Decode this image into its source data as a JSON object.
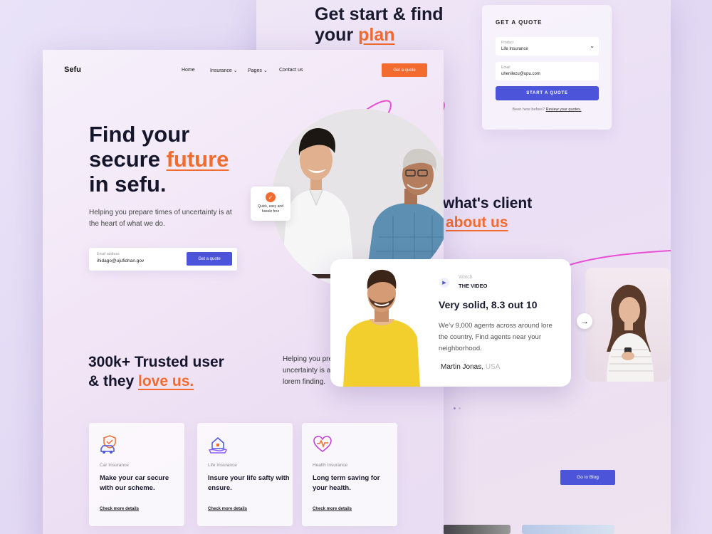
{
  "back": {
    "heading_l1": "Get start & find",
    "heading_l2a": "your ",
    "heading_l2b": "plan",
    "quote": {
      "title": "GET A QUOTE",
      "product_label": "Product",
      "product_value": "Life Insurance",
      "email_label": "Email",
      "email_value": "uhenilezu@upu.com",
      "button": "START A QUOTE",
      "note": "Been here before?",
      "note_link": "Review your quotes."
    },
    "client_l1": "what's client",
    "client_l2": "about us",
    "blog_button": "Go to Blog"
  },
  "front": {
    "logo": "Sefu",
    "nav": [
      "Home",
      "Insurance",
      "Pages",
      "Contact us"
    ],
    "header_button": "Get a quote",
    "hero_l1": "Find your",
    "hero_l2a": "secure ",
    "hero_l2b": "future",
    "hero_l3": "in sefu.",
    "hero_text": "Helping you prepare times of uncertainty is at the heart of what we do.",
    "email_label": "Email address",
    "email_value": "ihidago@ujufidnan.gov",
    "email_button": "Get a quote",
    "badge_text": "Quick, easy and hassle free",
    "trust_l1": "300k+ Trusted user",
    "trust_l2a": "& they ",
    "trust_l2b": "love us.",
    "trust_text_l1": "Helping you pre",
    "trust_text_l2": "uncertainty is a",
    "trust_text_l3": "lorem finding.",
    "cards": [
      {
        "category": "Car Insurance",
        "title": "Make your car secure with our scheme.",
        "link": "Check more details",
        "icon": "car-shield-icon"
      },
      {
        "category": "Life Insurance",
        "title": "Insure your life safty with ensure.",
        "link": "Check more details",
        "icon": "house-hand-icon"
      },
      {
        "category": "Health Insurance",
        "title": "Long term saving for your health.",
        "link": "Check more details",
        "icon": "heart-pulse-icon"
      }
    ]
  },
  "testimonial": {
    "watch": "Watch",
    "the_video": "THE VIDEO",
    "headline": "Very solid, 8.3 out 10",
    "quote": "We’v 9,000 agents across around lore the country, Find agents near your neighborhood.",
    "name": "Martin Jonas,",
    "country": "USA"
  },
  "colors": {
    "accent_orange": "#f26b2f",
    "accent_blue": "#4c55d9"
  }
}
